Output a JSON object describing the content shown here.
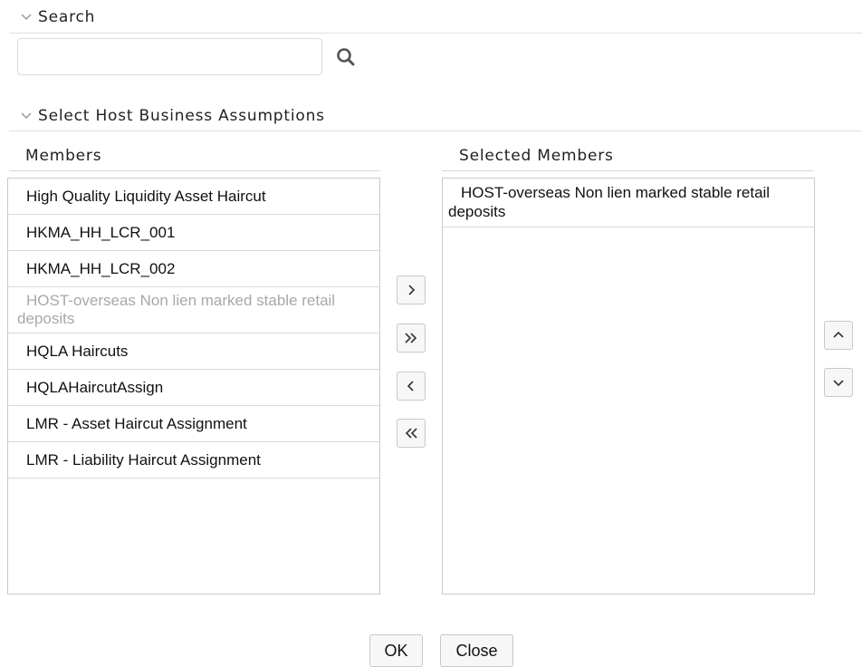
{
  "search_section": {
    "title": "Search",
    "input_value": ""
  },
  "assumptions_section": {
    "title": "Select Host Business Assumptions"
  },
  "members": {
    "title": "Members",
    "items": [
      {
        "label": "High Quality Liquidity Asset Haircut",
        "disabled": false
      },
      {
        "label": "HKMA_HH_LCR_001",
        "disabled": false
      },
      {
        "label": "HKMA_HH_LCR_002",
        "disabled": false
      },
      {
        "label": "HOST-overseas Non lien marked stable retail deposits",
        "disabled": true
      },
      {
        "label": "HQLA Haircuts",
        "disabled": false
      },
      {
        "label": "HQLAHaircutAssign",
        "disabled": false
      },
      {
        "label": "LMR - Asset Haircut Assignment",
        "disabled": false
      },
      {
        "label": "LMR - Liability Haircut Assignment",
        "disabled": false
      }
    ]
  },
  "selected_members": {
    "title": "Selected Members",
    "items": [
      {
        "label": "HOST-overseas Non lien marked stable retail deposits"
      }
    ]
  },
  "transfer_buttons": {
    "move_one_right": "chevron-right-icon",
    "move_all_right": "double-chevron-right-icon",
    "move_one_left": "chevron-left-icon",
    "move_all_left": "double-chevron-left-icon"
  },
  "order_buttons": {
    "move_up": "chevron-up-icon",
    "move_down": "chevron-down-icon"
  },
  "footer": {
    "ok_label": "OK",
    "close_label": "Close"
  }
}
